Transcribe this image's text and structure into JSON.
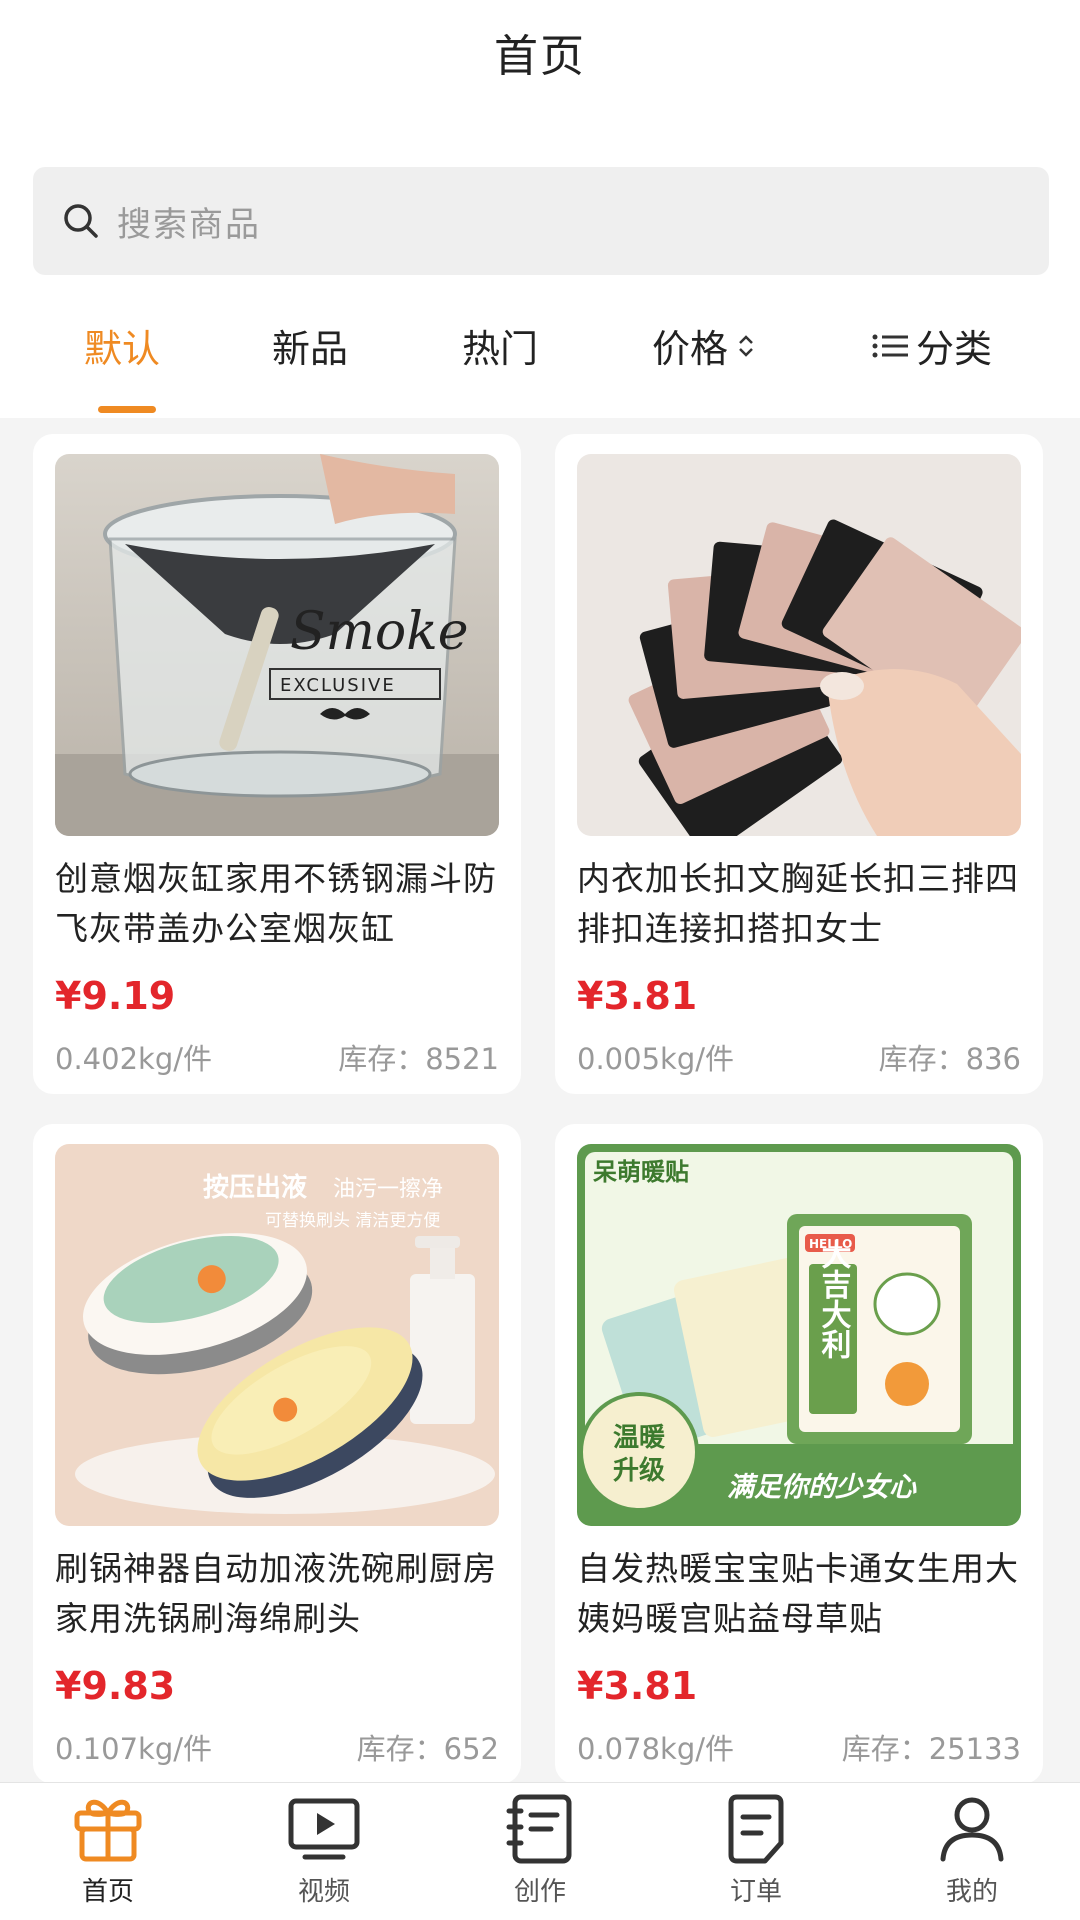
{
  "header": {
    "title": "首页"
  },
  "search": {
    "placeholder": "搜索商品",
    "icon": "search-icon"
  },
  "tabs": [
    {
      "label": "默认",
      "active": true
    },
    {
      "label": "新品",
      "active": false
    },
    {
      "label": "热门",
      "active": false
    },
    {
      "label": "价格",
      "active": false,
      "icon": "sort-icon"
    },
    {
      "label": "分类",
      "active": false,
      "icon": "list-icon"
    }
  ],
  "colors": {
    "accent": "#ef8a22",
    "price": "#e3262b"
  },
  "products": [
    {
      "name": "创意烟灰缸家用不锈钢漏斗防飞灰带盖办公室烟灰缸",
      "price": "¥9.19",
      "weight": "0.402kg/件",
      "stock": "库存：8521"
    },
    {
      "name": "内衣加长扣文胸延长扣三排四排扣连接扣搭扣女士",
      "price": "¥3.81",
      "weight": "0.005kg/件",
      "stock": "库存：836"
    },
    {
      "name": "刷锅神器自动加液洗碗刷厨房家用洗锅刷海绵刷头",
      "price": "¥9.83",
      "weight": "0.107kg/件",
      "stock": "库存：652"
    },
    {
      "name": "自发热暖宝宝贴卡通女生用大姨妈暖宫贴益母草贴",
      "price": "¥3.81",
      "weight": "0.078kg/件",
      "stock": "库存：25133"
    }
  ],
  "image_text": {
    "ashtray": [
      "Smoke",
      "EXCLUSIVE"
    ],
    "brush": [
      "按压出液",
      "油污一擦净",
      "可替换刷头 清洁更方便"
    ],
    "warmer": [
      "呆萌暖贴",
      "HELLO",
      "大吉大利",
      "温暖",
      "升级",
      "满足你的少女心"
    ]
  },
  "bottom_nav": [
    {
      "label": "首页",
      "icon": "gift-icon",
      "active": true
    },
    {
      "label": "视频",
      "icon": "video-icon",
      "active": false
    },
    {
      "label": "创作",
      "icon": "notebook-icon",
      "active": false
    },
    {
      "label": "订单",
      "icon": "order-icon",
      "active": false
    },
    {
      "label": "我的",
      "icon": "user-icon",
      "active": false
    }
  ]
}
